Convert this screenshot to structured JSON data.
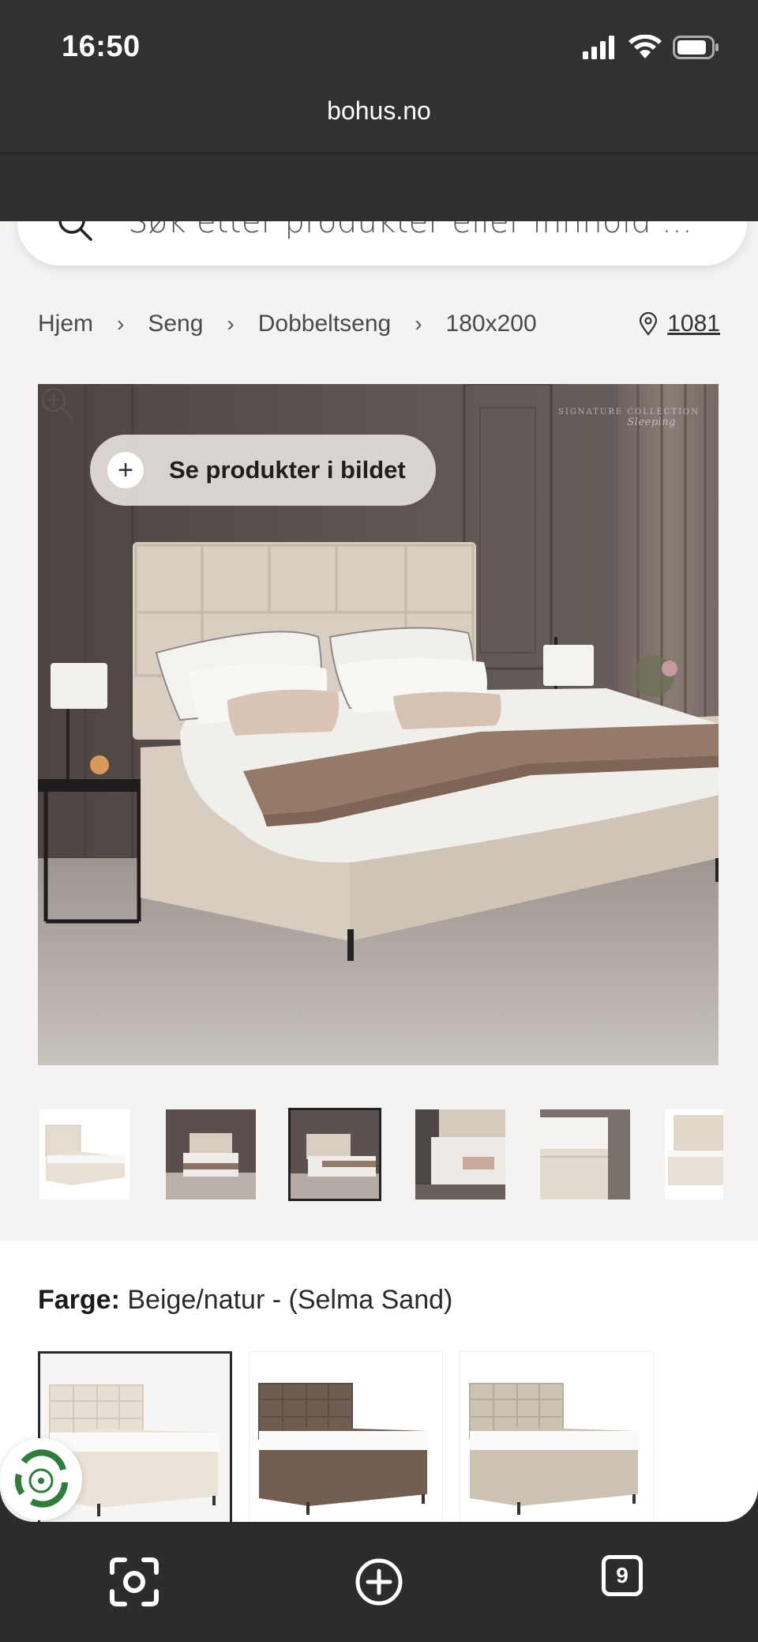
{
  "status_bar": {
    "time": "16:50"
  },
  "browser": {
    "url": "bohus.no",
    "tab_count": "9"
  },
  "search": {
    "placeholder": "Søk etter produkter eller innhold ..."
  },
  "breadcrumb": {
    "items": [
      "Hjem",
      "Seng",
      "Dobbeltseng",
      "180x200"
    ]
  },
  "store": {
    "label": "1081"
  },
  "hero": {
    "products_button": "Se produkter i bildet",
    "watermark_line1": "SIGNATURE COLLECTION",
    "watermark_line2": "Sleeping"
  },
  "color": {
    "label": "Farge:",
    "value": "Beige/natur - (Selma Sand)",
    "swatches": [
      "#e6e0d4",
      "#6e5e52",
      "#cbc2b2"
    ]
  },
  "icons": {
    "search": "search-icon",
    "location": "location-pin-icon",
    "zoom": "zoom-in-icon",
    "camera": "camera-icon",
    "new_tab": "plus-circle-icon",
    "tabs": "tabs-icon",
    "badge": "recycle-badge-icon"
  }
}
